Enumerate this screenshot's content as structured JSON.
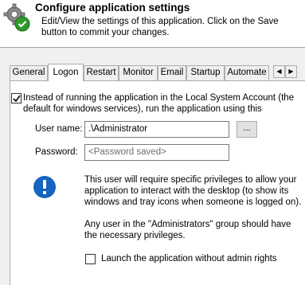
{
  "header": {
    "title": "Configure application settings",
    "description": "Edit/View the settings of this application. Click on the Save button to commit your changes.",
    "icon": "gear-check-icon"
  },
  "tabs": [
    {
      "label": "General",
      "active": false
    },
    {
      "label": "Logon",
      "active": true
    },
    {
      "label": "Restart",
      "active": false
    },
    {
      "label": "Monitor",
      "active": false
    },
    {
      "label": "Email",
      "active": false
    },
    {
      "label": "Startup",
      "active": false
    },
    {
      "label": "Automate",
      "active": false
    }
  ],
  "tab_scroll": {
    "left": "◀",
    "right": "▶"
  },
  "logon": {
    "run_as_checked": true,
    "run_as_label": "Instead of running the application in the Local System Account (the default for windows services), run the application using this",
    "username_label": "User name:",
    "username_value": ".\\Administrator",
    "browse_label": "...",
    "password_label": "Password:",
    "password_placeholder": "<Password saved>",
    "info_icon": "info-icon",
    "info_text_1": "This user will require specific privileges to allow your application to interact with the desktop (to show its windows and tray icons when someone is logged on).",
    "info_text_2": "Any user in the \"Administrators\" group should have the necessary privileges.",
    "launch_without_admin_checked": false,
    "launch_without_admin_label": "Launch the application without admin rights"
  },
  "colors": {
    "panel_bg": "#ffffff",
    "chrome_bg": "#f0f0f0",
    "info_blue": "#1565c0"
  }
}
